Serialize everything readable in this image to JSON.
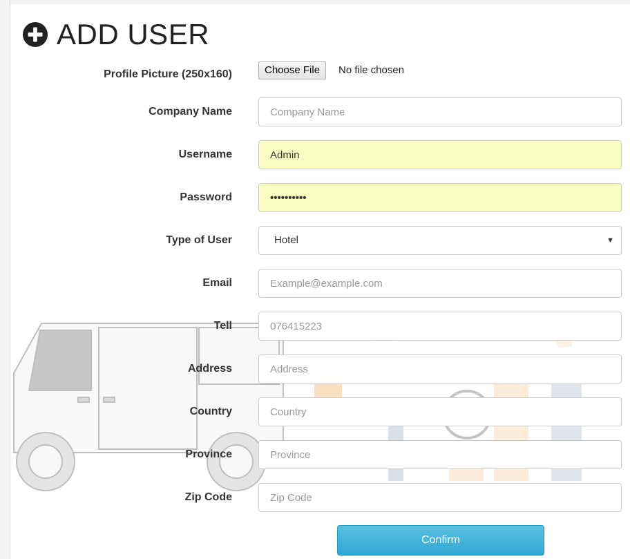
{
  "page": {
    "title": "ADD USER",
    "title_icon": "plus-circle-icon"
  },
  "form": {
    "profile_picture": {
      "label": "Profile Picture (250x160)",
      "button_label": "Choose File",
      "status": "No file chosen"
    },
    "company_name": {
      "label": "Company Name",
      "placeholder": "Company Name",
      "value": ""
    },
    "username": {
      "label": "Username",
      "value": "Admin"
    },
    "password": {
      "label": "Password",
      "value": "••••••••••"
    },
    "type_of_user": {
      "label": "Type of User",
      "selected": "Hotel",
      "arrow": "▼"
    },
    "email": {
      "label": "Email",
      "placeholder": "Example@example.com"
    },
    "tell": {
      "label": "Tell",
      "placeholder": "076415223"
    },
    "address": {
      "label": "Address",
      "placeholder": "Address"
    },
    "country": {
      "label": "Country",
      "placeholder": "Country"
    },
    "province": {
      "label": "Province",
      "placeholder": "Province"
    },
    "zip_code": {
      "label": "Zip Code",
      "placeholder": "Zip Code"
    },
    "confirm_label": "Confirm"
  },
  "colors": {
    "autofill_bg": "#fafdc2",
    "confirm_bg": "#31a8d6",
    "label_text": "#333333"
  }
}
